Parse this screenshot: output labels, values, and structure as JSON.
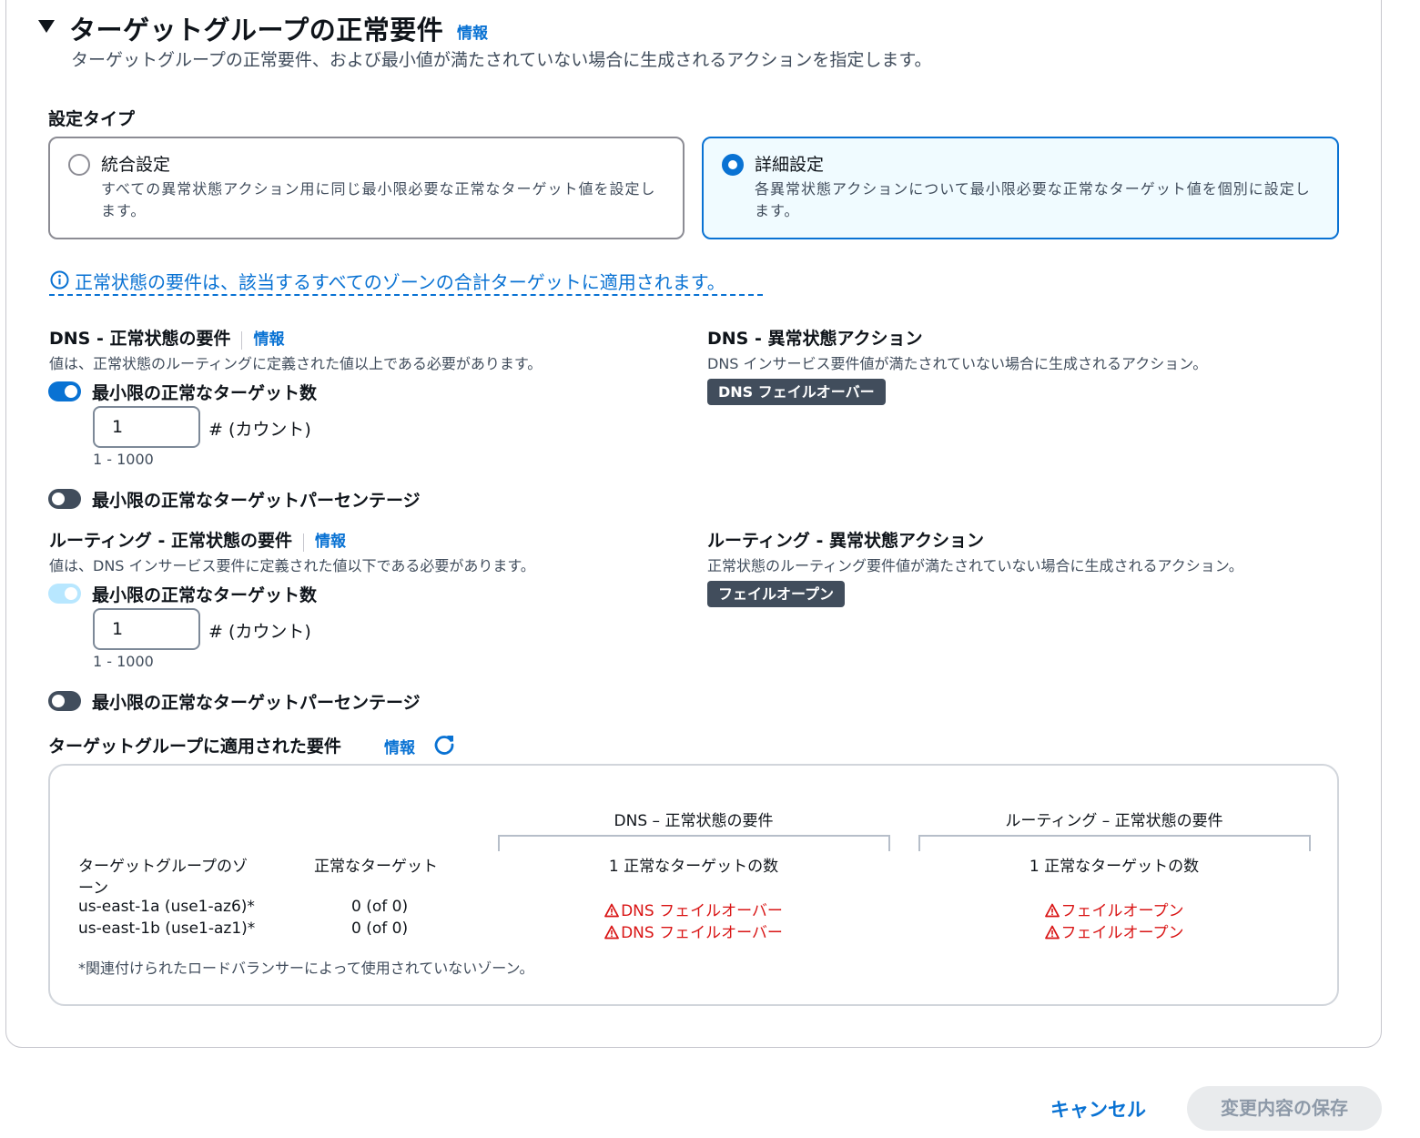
{
  "section": {
    "title": "ターゲットグループの正常要件",
    "info": "情報",
    "description": "ターゲットグループの正常要件、および最小値が満たされていない場合に生成されるアクションを指定します。"
  },
  "config_type": {
    "label": "設定タイプ",
    "options": [
      {
        "title": "統合設定",
        "description": "すべての異常状態アクション用に同じ最小限必要な正常なターゲット値を設定します。",
        "selected": false
      },
      {
        "title": "詳細設定",
        "description": "各異常状態アクションについて最小限必要な正常なターゲット値を個別に設定します。",
        "selected": true
      }
    ]
  },
  "alert": "正常状態の要件は、該当するすべてのゾーンの合計ターゲットに適用されます。",
  "dns_req": {
    "title": "DNS - 正常状態の要件",
    "info": "情報",
    "description": "値は、正常状態のルーティングに定義された値以上である必要があります。",
    "min_count_label": "最小限の正常なターゲット数",
    "min_count_enabled": true,
    "count_value": "1",
    "count_unit": "# (カウント)",
    "count_constraint": "1 - 1000",
    "min_pct_label": "最小限の正常なターゲットパーセンテージ",
    "min_pct_enabled": false
  },
  "dns_action": {
    "title": "DNS - 異常状態アクション",
    "description": "DNS インサービス要件値が満たされていない場合に生成されるアクション。",
    "badge": "DNS フェイルオーバー"
  },
  "routing_req": {
    "title": "ルーティング - 正常状態の要件",
    "info": "情報",
    "description": "値は、DNS インサービス要件に定義された値以下である必要があります。",
    "min_count_label": "最小限の正常なターゲット数",
    "min_count_enabled": true,
    "count_value": "1",
    "count_unit": "# (カウント)",
    "count_constraint": "1 - 1000",
    "min_pct_label": "最小限の正常なターゲットパーセンテージ",
    "min_pct_enabled": false
  },
  "routing_action": {
    "title": "ルーティング - 異常状態アクション",
    "description": "正常状態のルーティング要件値が満たされていない場合に生成されるアクション。",
    "badge": "フェイルオープン"
  },
  "applied": {
    "title": "ターゲットグループに適用された要件",
    "info": "情報",
    "group_headers": {
      "dns": "DNS – 正常状態の要件",
      "routing": "ルーティング – 正常状態の要件"
    },
    "col_zone_line1": "ターゲットグループのゾ",
    "col_zone_line2": "ーン",
    "col_healthy": "正常なターゲット",
    "col_dns": "1 正常なターゲットの数",
    "col_routing": "1 正常なターゲットの数",
    "rows": [
      {
        "zone": "us-east-1a (use1-az6)*",
        "healthy": "0 (of 0)",
        "dns": "DNS フェイルオーバー",
        "routing": "フェイルオープン"
      },
      {
        "zone": "us-east-1b (use1-az1)*",
        "healthy": "0 (of 0)",
        "dns": "DNS フェイルオーバー",
        "routing": "フェイルオープン"
      }
    ],
    "footnote": "*関連付けられたロードバランサーによって使用されていないゾーン。"
  },
  "footer": {
    "cancel": "キャンセル",
    "save": "変更内容の保存"
  },
  "colors": {
    "accent": "#0972d3",
    "error": "#d91515",
    "badge_bg": "#414d5c",
    "disabled_btn": "#e9ebed"
  }
}
